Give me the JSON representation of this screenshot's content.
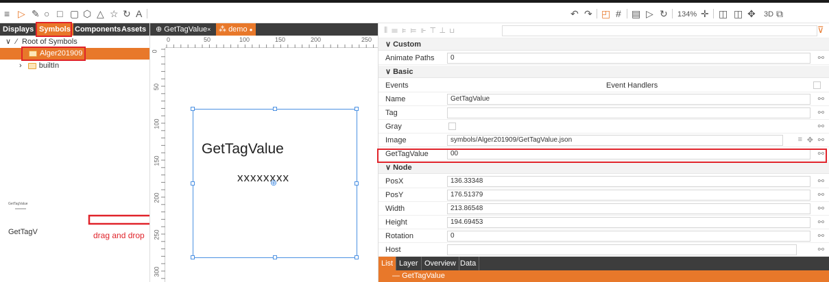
{
  "left_tabs": [
    "Displays",
    "Symbols",
    "Components",
    "Assets"
  ],
  "tree": {
    "root": "Root of Symbols",
    "selected": "Alger201909",
    "other": "builtIn"
  },
  "thumb": {
    "small_title": "GetTagValue",
    "small_sub": "xxxxxxxx",
    "label": "GetTagV"
  },
  "drag_label": "drag and drop",
  "center_tabs": [
    "GetTagValue",
    "demo"
  ],
  "ruler": {
    "h": [
      "0",
      "50",
      "100",
      "150",
      "200",
      "250"
    ],
    "v": [
      "0",
      "50",
      "100",
      "150",
      "200",
      "250",
      "300"
    ]
  },
  "canvas": {
    "title": "GetTagValue",
    "value": "xxxxxxxx"
  },
  "toolbar": {
    "zoom": "134%",
    "mode3d": "3D"
  },
  "props": {
    "sections": {
      "custom": "Custom",
      "basic": "Basic",
      "node": "Node"
    },
    "animate_paths": {
      "label": "Animate Paths",
      "value": "0"
    },
    "events": {
      "label": "Events",
      "value": "Event Handlers"
    },
    "name": {
      "label": "Name",
      "value": "GetTagValue"
    },
    "tag": {
      "label": "Tag",
      "value": ""
    },
    "gray": {
      "label": "Gray"
    },
    "image": {
      "label": "Image",
      "value": "symbols/Alger201909/GetTagValue.json"
    },
    "gettagvalue": {
      "label": "GetTagValue",
      "value": "00"
    },
    "posx": {
      "label": "PosX",
      "value": "136.33348"
    },
    "posy": {
      "label": "PosY",
      "value": "176.51379"
    },
    "width": {
      "label": "Width",
      "value": "213.86548"
    },
    "height": {
      "label": "Height",
      "value": "194.69453"
    },
    "rotation": {
      "label": "Rotation",
      "value": "0"
    },
    "host": {
      "label": "Host",
      "value": ""
    }
  },
  "bottom_tabs": [
    "List",
    "Layer",
    "Overview",
    "Data"
  ],
  "list_item": "GetTagValue",
  "colors": {
    "accent": "#e8782a",
    "highlight": "#e0232a"
  }
}
